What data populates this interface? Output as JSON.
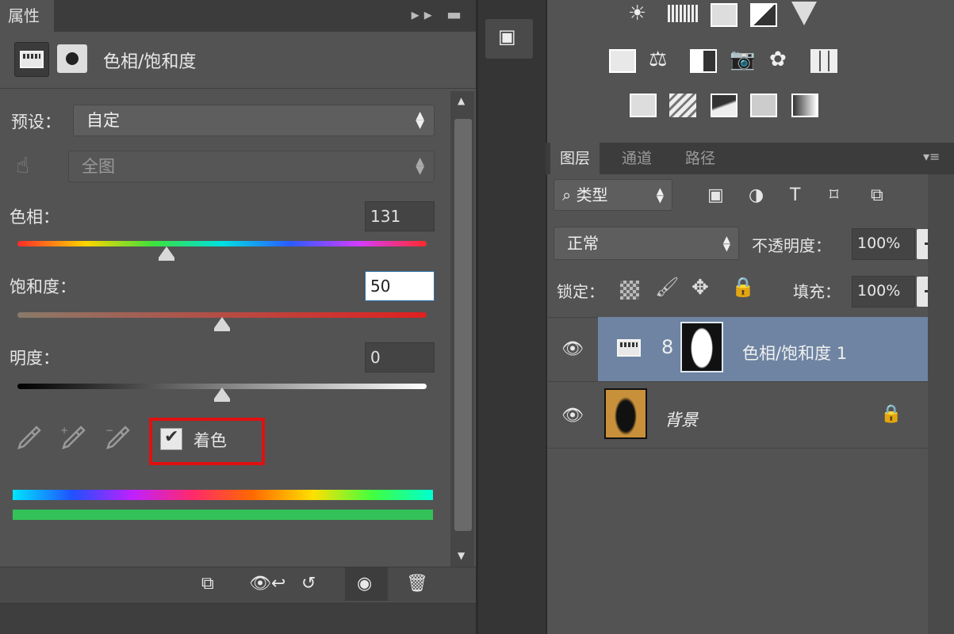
{
  "properties_panel": {
    "tab_label": "属性",
    "tab_icons": "▸▸ ▬",
    "title": "色相/饱和度",
    "preset_label": "预设：",
    "preset_value": "自定",
    "range_value": "全图",
    "hue": {
      "label": "色相：",
      "value": "131",
      "level": 0.36
    },
    "saturation": {
      "label": "饱和度：",
      "value": "50",
      "level": 0.5
    },
    "lightness": {
      "label": "明度：",
      "value": "0",
      "level": 0.5
    },
    "colorize": {
      "label": "着色",
      "checked": true
    },
    "highlight_color": "#e01010"
  },
  "bottom_toolbar": {
    "clip_icon": "clip-to-layer-icon",
    "view_prev_icon": "view-previous-state-icon",
    "reset_icon": "reset-icon",
    "visibility_icon": "toggle-visibility-icon",
    "delete_icon": "delete-icon"
  },
  "layers_panel": {
    "tabs": [
      "图层",
      "通道",
      "路径"
    ],
    "kind_filter": "类型",
    "blend_mode": "正常",
    "opacity_label": "不透明度：",
    "opacity_value": "100%",
    "lock_label": "锁定：",
    "fill_label": "填充：",
    "fill_value": "100%",
    "layers": [
      {
        "name": "色相/饱和度 1",
        "selected": true,
        "visible": true
      },
      {
        "name": "背景",
        "selected": false,
        "visible": true,
        "locked": true
      }
    ]
  }
}
